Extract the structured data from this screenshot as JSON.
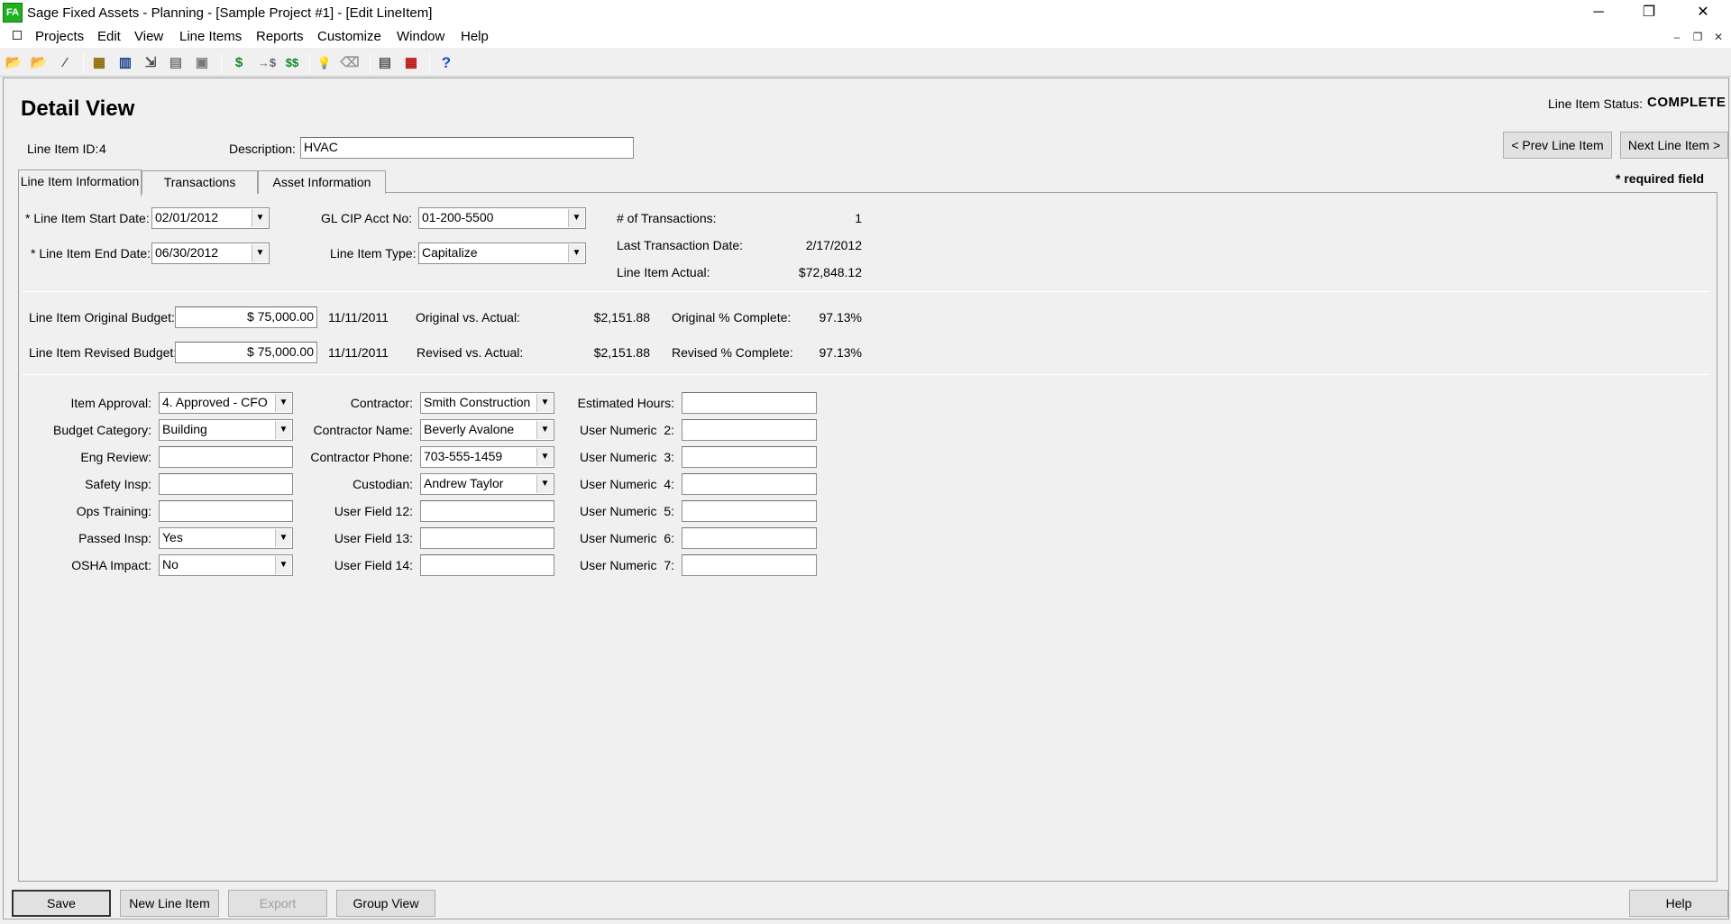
{
  "window": {
    "title": "Sage Fixed Assets - Planning - [Sample Project #1] - [Edit LineItem]",
    "minimize": "─",
    "restore": "❐",
    "close": "✕"
  },
  "menu": [
    "Projects",
    "Edit",
    "View",
    "Line Items",
    "Reports",
    "Customize",
    "Window",
    "Help"
  ],
  "mdi": {
    "min": "‒",
    "restore": "❐",
    "close": "✕"
  },
  "toolbar": {
    "icons": [
      "folder-open-icon",
      "folder-edit-icon",
      "wand-icon",
      "grid-icon",
      "chart-icon",
      "move-icon",
      "stack-icon",
      "folder-stack-icon",
      "dollar-icon",
      "transfer-dollar-icon",
      "double-dollar-icon",
      "lightbulb-icon",
      "lightbulb-off-icon",
      "calculator-icon",
      "calendar-icon",
      "help-icon"
    ],
    "glyphs": [
      "📂",
      "📂",
      "⁄",
      "▦",
      "▥",
      "⇲",
      "▤",
      "▣",
      "$",
      "→$",
      "$$",
      "💡",
      "⌫",
      "▤",
      "▦",
      "?"
    ]
  },
  "header": {
    "title": "Detail View",
    "status_label": "Line Item Status:",
    "status_value": "COMPLETE",
    "line_item_id_label": "Line Item ID:",
    "line_item_id": "4",
    "description_label": "Description:",
    "description": "HVAC",
    "prev_button": "< Prev Line Item",
    "next_button": "Next Line Item >",
    "required_note": "* required field"
  },
  "tabs": [
    "Line Item Information",
    "Transactions",
    "Asset Information"
  ],
  "section1": {
    "start_date_label": "* Line Item Start Date:",
    "start_date": "02/01/2012",
    "end_date_label": "* Line Item End Date:",
    "end_date": "06/30/2012",
    "gl_label": "GL CIP Acct No:",
    "gl_value": "01-200-5500",
    "type_label": "Line Item Type:",
    "type_value": "Capitalize",
    "num_trans_label": "# of Transactions:",
    "num_trans": "1",
    "last_trans_label": "Last Transaction Date:",
    "last_trans": "2/17/2012",
    "actual_label": "Line Item Actual:",
    "actual": "$72,848.12"
  },
  "section2": {
    "orig_budget_label": "Line Item Original Budget:",
    "orig_budget": "$ 75,000.00",
    "orig_date": "11/11/2011",
    "orig_vs_label": "Original vs. Actual:",
    "orig_vs": "$2,151.88",
    "orig_pct_label": "Original % Complete:",
    "orig_pct": "97.13%",
    "rev_budget_label": "Line Item Revised Budget:",
    "rev_budget": "$ 75,000.00",
    "rev_date": "11/11/2011",
    "rev_vs_label": "Revised vs. Actual:",
    "rev_vs": "$2,151.88",
    "rev_pct_label": "Revised % Complete:",
    "rev_pct": "97.13%"
  },
  "section3": {
    "col1": [
      {
        "label": "Item Approval:",
        "value": "4. Approved - CFO",
        "combo": true
      },
      {
        "label": "Budget Category:",
        "value": "Building",
        "combo": true
      },
      {
        "label": "Eng Review:",
        "value": "",
        "combo": false
      },
      {
        "label": "Safety Insp:",
        "value": "",
        "combo": false
      },
      {
        "label": "Ops Training:",
        "value": "",
        "combo": false
      },
      {
        "label": "Passed Insp:",
        "value": "Yes",
        "combo": true
      },
      {
        "label": "OSHA Impact:",
        "value": "No",
        "combo": true
      }
    ],
    "col2": [
      {
        "label": "Contractor:",
        "value": "Smith Construction",
        "combo": true
      },
      {
        "label": "Contractor Name:",
        "value": "Beverly Avalone",
        "combo": true
      },
      {
        "label": "Contractor Phone:",
        "value": "703-555-1459",
        "combo": true
      },
      {
        "label": "Custodian:",
        "value": "Andrew Taylor",
        "combo": true
      },
      {
        "label": "User Field 12:",
        "value": "",
        "combo": false
      },
      {
        "label": "User Field 13:",
        "value": "",
        "combo": false
      },
      {
        "label": "User Field 14:",
        "value": "",
        "combo": false
      }
    ],
    "col3": [
      {
        "label": "Estimated Hours:",
        "value": ""
      },
      {
        "label": "User Numeric  2:",
        "value": ""
      },
      {
        "label": "User Numeric  3:",
        "value": ""
      },
      {
        "label": "User Numeric  4:",
        "value": ""
      },
      {
        "label": "User Numeric  5:",
        "value": ""
      },
      {
        "label": "User Numeric  6:",
        "value": ""
      },
      {
        "label": "User Numeric  7:",
        "value": ""
      }
    ]
  },
  "footer": {
    "save": "Save",
    "new_line_item": "New Line Item",
    "export": "Export",
    "group_view": "Group View",
    "help": "Help"
  },
  "combo_arrow": "▼"
}
